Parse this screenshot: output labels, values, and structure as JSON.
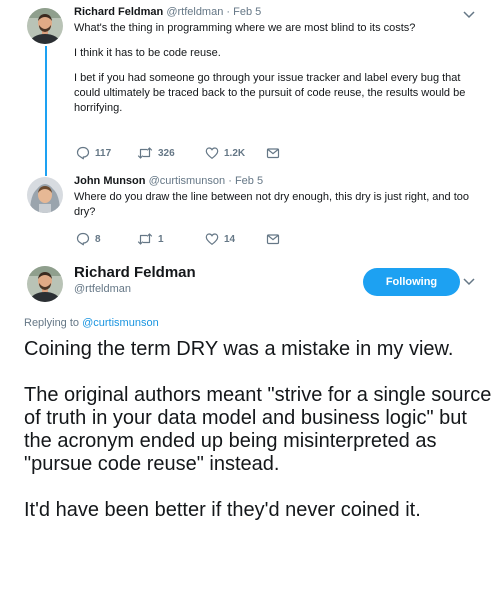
{
  "thread": [
    {
      "name": "Richard Feldman",
      "handle": "@rtfeldman",
      "separator": "·",
      "date": "Feb 5",
      "paragraphs": [
        "What's the thing in programming where we are most blind to its costs?",
        "I think it has to be code reuse.",
        "I bet if you had someone go through your issue tracker and label every bug that could ultimately be traced back to the pursuit of code reuse, the results would be horrifying."
      ],
      "replies": "117",
      "retweets": "326",
      "likes": "1.2K"
    },
    {
      "name": "John Munson",
      "handle": "@curtismunson",
      "separator": "·",
      "date": "Feb 5",
      "paragraphs": [
        "Where do you draw the line between not dry enough, this dry is just right, and too dry?"
      ],
      "replies": "8",
      "retweets": "1",
      "likes": "14"
    }
  ],
  "main_tweet": {
    "name": "Richard Feldman",
    "handle": "@rtfeldman",
    "follow_label": "Following",
    "replying_prefix": "Replying to",
    "replying_to": "@curtismunson",
    "paragraphs": [
      "Coining the term DRY was a mistake in my view.",
      "The original authors meant \"strive for a single source of truth in your data model and business logic\" but the acronym ended up being misinterpreted as \"pursue code reuse\" instead.",
      "It'd have been better if they'd never coined it."
    ]
  },
  "icons": [
    "reply-icon",
    "retweet-icon",
    "like-icon",
    "dm-icon",
    "chevron-down-icon"
  ],
  "colors": {
    "accent": "#1da1f2",
    "muted": "#657786",
    "text": "#14171a",
    "link": "#1b95e0"
  }
}
